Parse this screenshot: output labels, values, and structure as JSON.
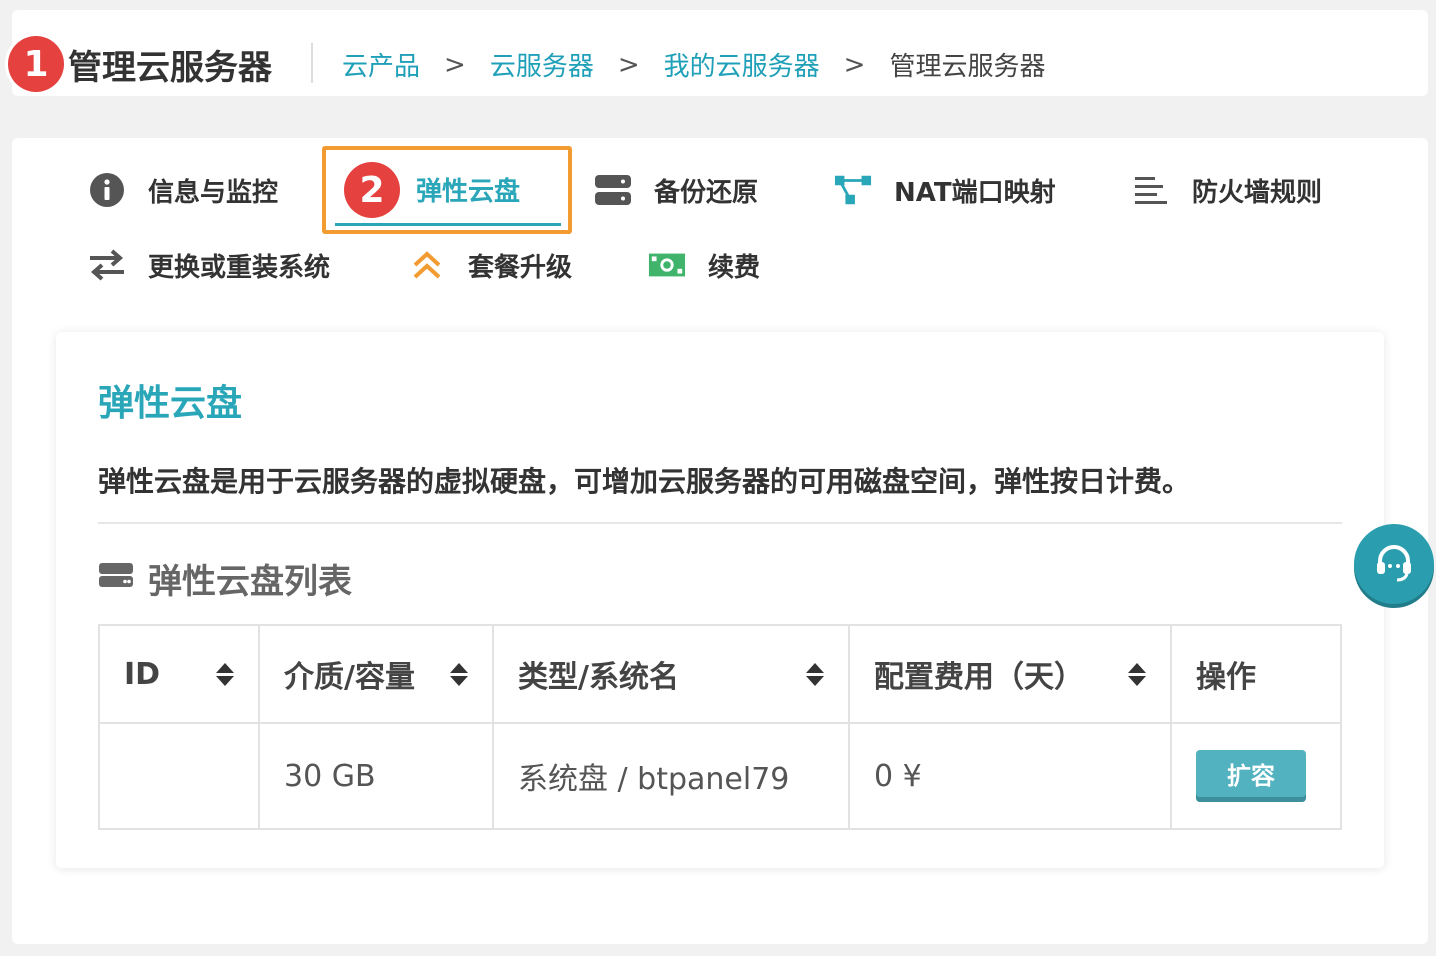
{
  "header": {
    "step_badge": "1",
    "title": "管理云服务器",
    "breadcrumb": [
      "云产品",
      "云服务器",
      "我的云服务器"
    ],
    "breadcrumb_current": "管理云服务器",
    "separator": ">"
  },
  "nav": {
    "active_badge": "2",
    "items": [
      {
        "label": "信息与监控",
        "icon": "info-icon"
      },
      {
        "label": "弹性云盘",
        "icon": "none",
        "active": true
      },
      {
        "label": "备份还原",
        "icon": "server-icon"
      },
      {
        "label": "NAT端口映射",
        "icon": "network-icon"
      },
      {
        "label": "防火墙规则",
        "icon": "list-icon"
      },
      {
        "label": "更换或重装系统",
        "icon": "swap-icon"
      },
      {
        "label": "套餐升级",
        "icon": "upgrade-icon"
      },
      {
        "label": "续费",
        "icon": "money-icon"
      }
    ]
  },
  "panel": {
    "title": "弹性云盘",
    "description": "弹性云盘是用于云服务器的虚拟硬盘，可增加云服务器的可用磁盘空间，弹性按日计费。",
    "list_title": "弹性云盘列表",
    "table": {
      "columns": [
        "ID",
        "介质/容量",
        "类型/系统名",
        "配置费用（天）",
        "操作"
      ],
      "rows": [
        {
          "id": "",
          "capacity": "30 GB",
          "type": "系统盘 / btpanel79",
          "cost": "0 ¥",
          "action": "扩容"
        }
      ]
    }
  },
  "colors": {
    "accent": "#2aa6b9",
    "badge": "#e5413f",
    "highlight": "#f29b30",
    "button": "#52b2c0"
  }
}
